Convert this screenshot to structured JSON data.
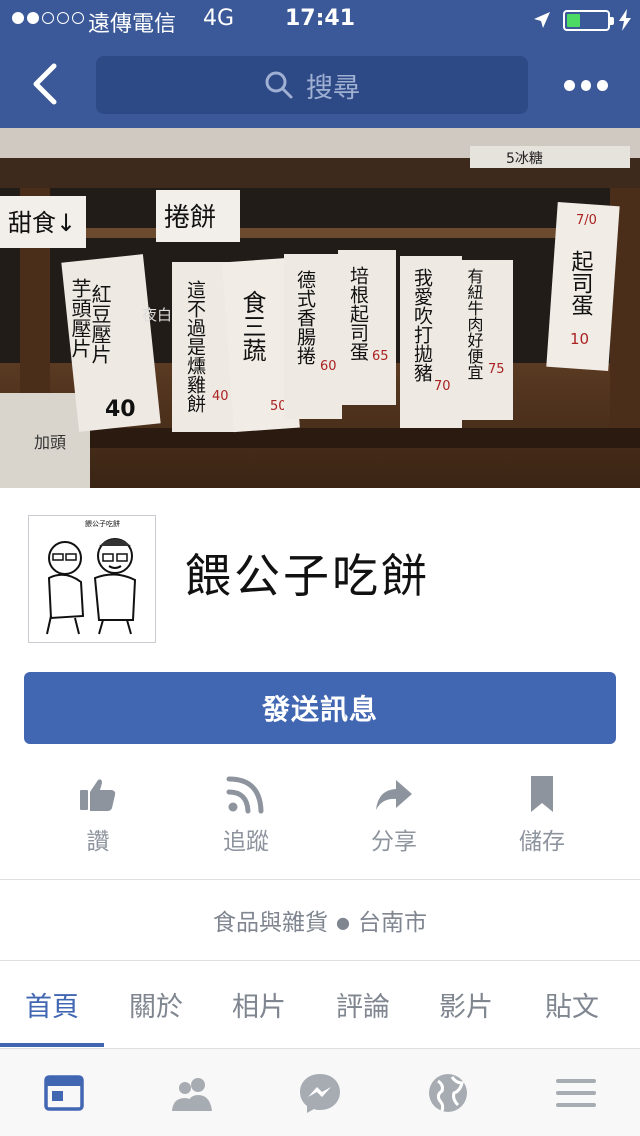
{
  "status_bar": {
    "carrier": "遠傳電信",
    "network": "4G",
    "time": "17:41",
    "signal_bars_filled": 2,
    "signal_bars_total": 5,
    "battery_level": 0.3
  },
  "nav": {
    "search_label": "搜尋"
  },
  "page": {
    "name": "餵公子吃餅",
    "send_message_label": "發送訊息",
    "category": "食品與雜貨",
    "location": "台南市",
    "profile_caption": "餵公子吃餅"
  },
  "actions": [
    {
      "label": "讚",
      "icon": "thumbs-up-icon"
    },
    {
      "label": "追蹤",
      "icon": "rss-follow-icon"
    },
    {
      "label": "分享",
      "icon": "share-arrow-icon"
    },
    {
      "label": "儲存",
      "icon": "bookmark-icon"
    }
  ],
  "tabs": [
    {
      "label": "首頁",
      "active": true
    },
    {
      "label": "關於"
    },
    {
      "label": "相片"
    },
    {
      "label": "評論"
    },
    {
      "label": "影片"
    },
    {
      "label": "貼文"
    }
  ],
  "bottom_nav": [
    {
      "icon": "news-feed-icon",
      "active": true
    },
    {
      "icon": "friends-icon"
    },
    {
      "icon": "messenger-icon"
    },
    {
      "icon": "globe-notifications-icon"
    },
    {
      "icon": "menu-icon"
    }
  ],
  "cover_signs": {
    "left_label": "甜食↓",
    "top_label": "捲餅",
    "menu_1": "紅豆壓片",
    "menu_1_b": "芋頭壓片",
    "menu_1_price": "40",
    "menu_2": "這不過是燻雞餅",
    "menu_2_price": "40",
    "menu_3": "食三蔬",
    "menu_3_price": "50",
    "menu_4": "德式香腸捲",
    "menu_4_price": "60",
    "menu_5": "培根起司蛋",
    "menu_5_price": "65",
    "menu_6": "我愛吹打拋豬",
    "menu_6_price": "70",
    "menu_7": "有紐牛肉好便宜",
    "menu_7_price": "75",
    "menu_8": "起司蛋",
    "menu_8_top": "7/0",
    "menu_8_price": "10",
    "night_text": "夜白",
    "board_text": "5冰糖",
    "bottom_left": "加頭"
  },
  "colors": {
    "brand_blue": "#3b5998",
    "button_blue": "#4267b2",
    "muted_gray": "#8d949e"
  }
}
